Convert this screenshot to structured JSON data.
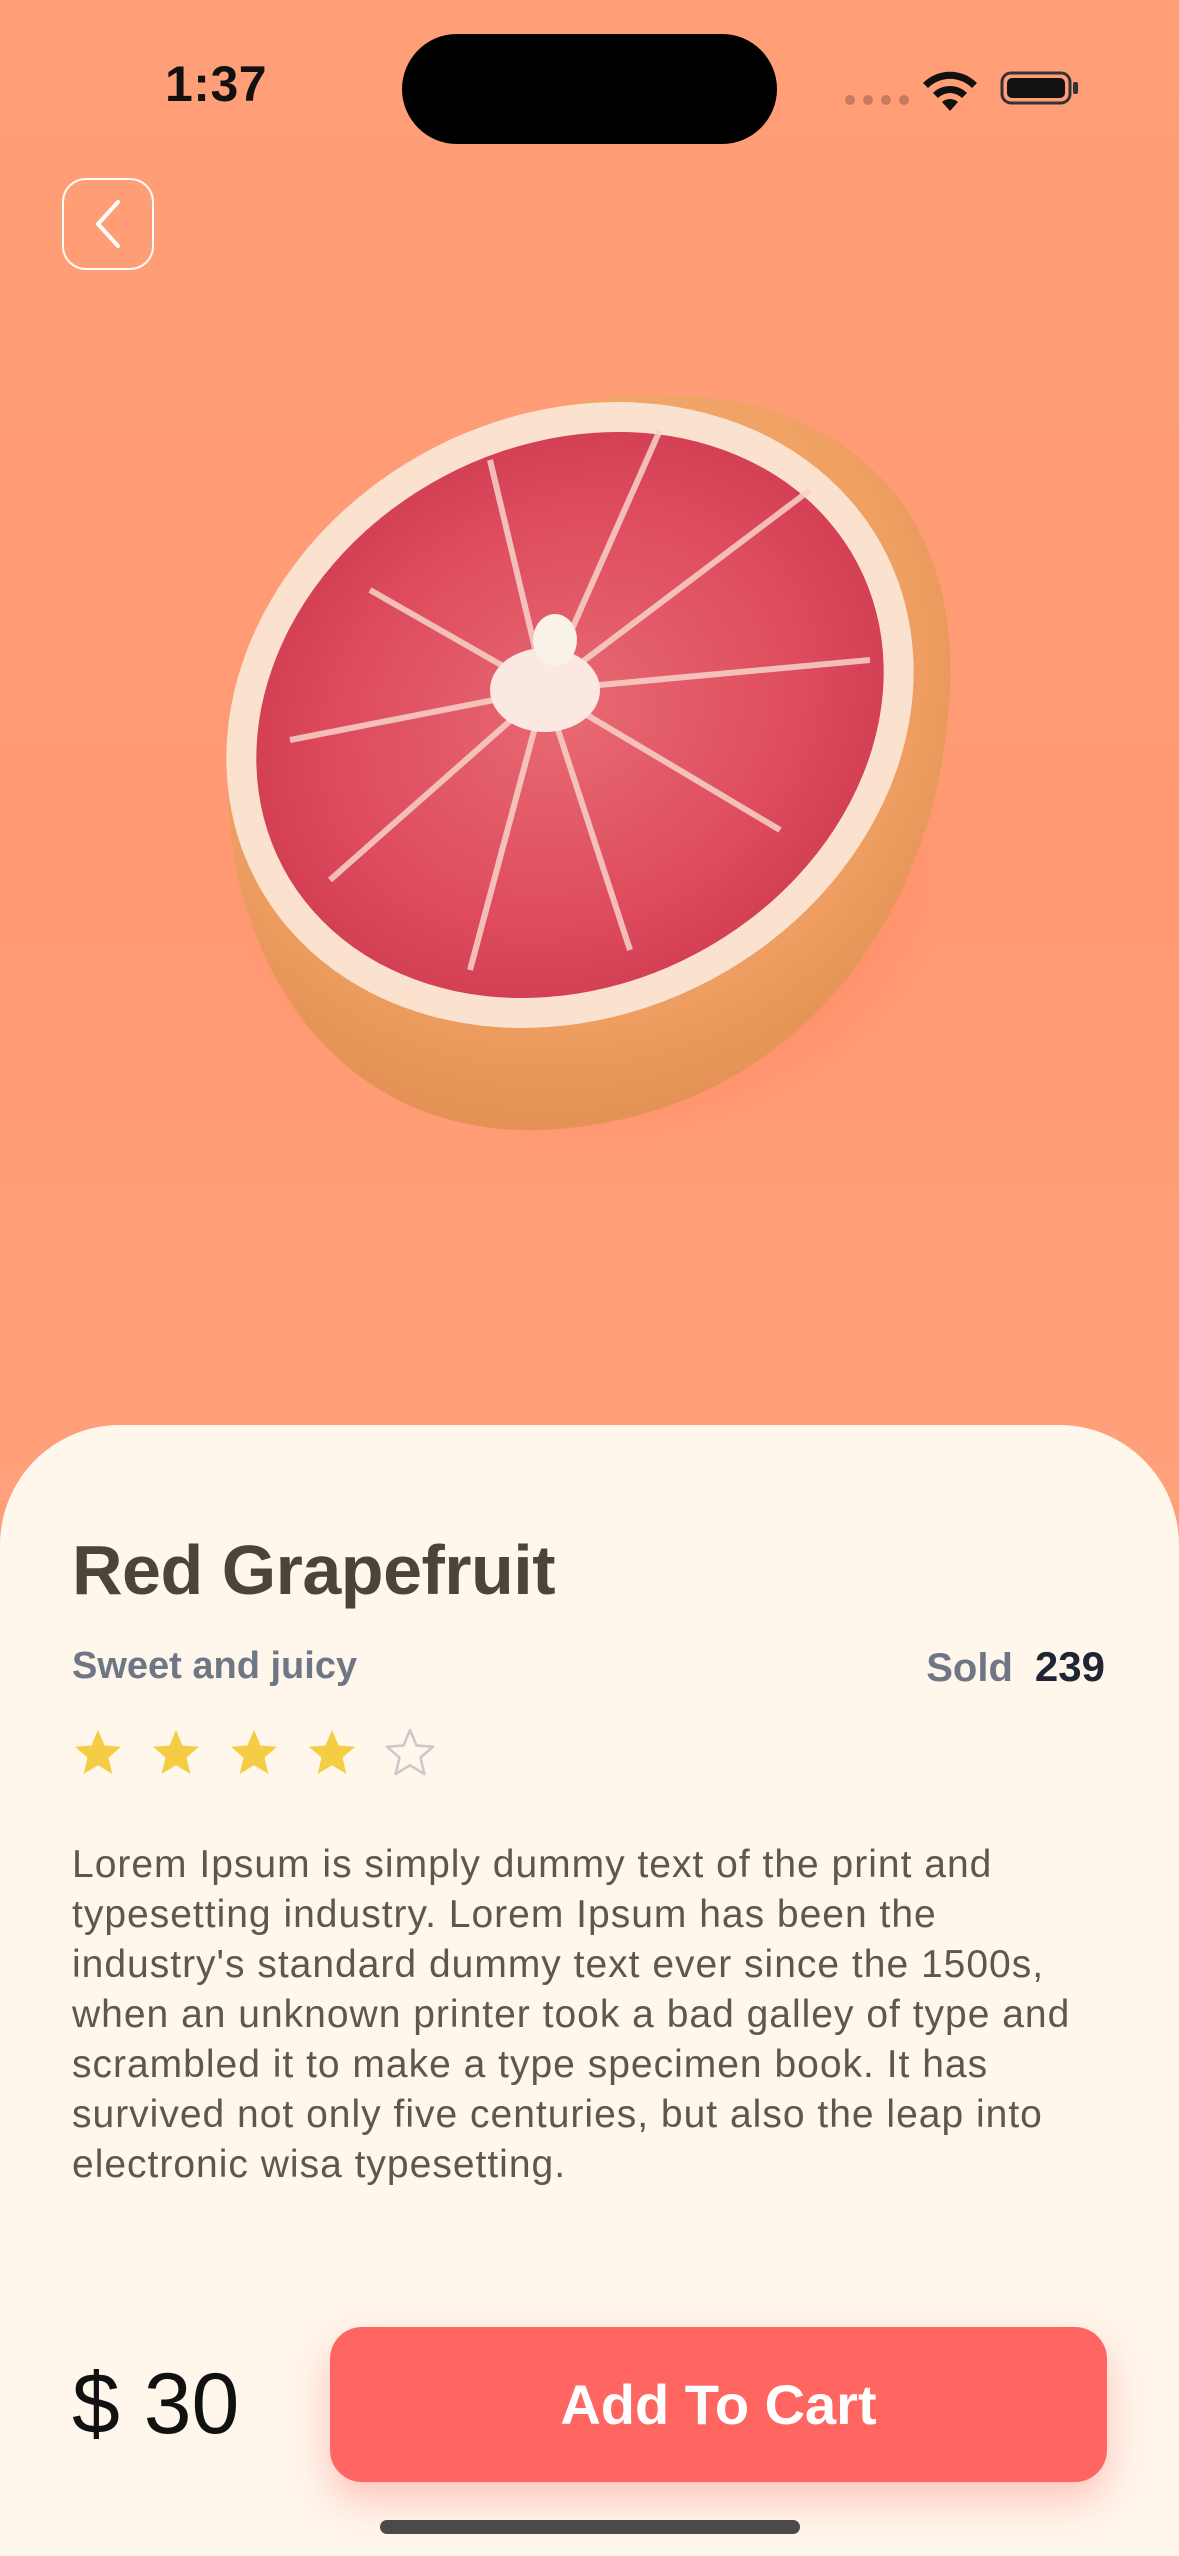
{
  "status_bar": {
    "time": "1:37"
  },
  "product": {
    "name": "Red Grapefruit",
    "subtitle": "Sweet and juicy",
    "sold_label": "Sold",
    "sold_count": "239",
    "rating": 4,
    "rating_max": 5,
    "description": "Lorem Ipsum is simply dummy text of the print and typesetting industry. Lorem Ipsum has been the industry's standard dummy text ever since the 1500s, when an unknown printer took a bad galley of type and scrambled it to make a type specimen book. It has survived not only five centuries, but also the leap into electronic wisa typesetting.",
    "price": "$ 30",
    "image_icon": "grapefruit-half-image"
  },
  "actions": {
    "add_to_cart_label": "Add To Cart",
    "back_icon": "chevron-left-icon"
  },
  "colors": {
    "hero_bg": "#ff9f77",
    "card_bg": "#fff6ec",
    "accent": "#ff6561",
    "star_filled": "#f5cd45",
    "star_empty": "#c9c9c9",
    "title": "#4a4536"
  }
}
